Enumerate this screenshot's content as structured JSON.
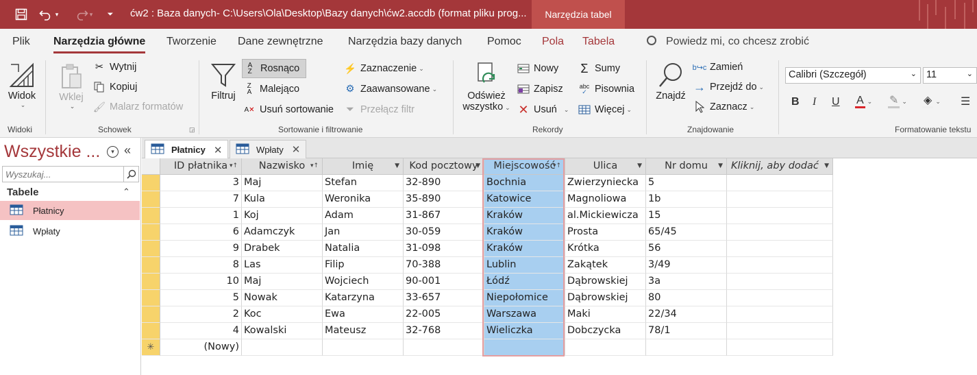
{
  "title_bar": {
    "title": "ćw2 : Baza danych- C:\\Users\\Ola\\Desktop\\Bazy danych\\ćw2.accdb (format pliku prog...",
    "context_tab": "Narzędzia tabel",
    "accent": "#a4373a"
  },
  "ribbon_tabs": [
    "Plik",
    "Narzędzia główne",
    "Tworzenie",
    "Dane zewnętrzne",
    "Narzędzia bazy danych",
    "Pomoc",
    "Pola",
    "Tabela"
  ],
  "active_tab": "Narzędzia główne",
  "tell_me": "Powiedz mi, co chcesz zrobić",
  "ribbon": {
    "widoki": {
      "widok": "Widok",
      "label": "Widoki"
    },
    "schowek": {
      "wklej": "Wklej",
      "wytnij": "Wytnij",
      "kopiuj": "Kopiuj",
      "malarz": "Malarz formatów",
      "label": "Schowek"
    },
    "sortowanie": {
      "filtruj": "Filtruj",
      "rosnaco": "Rosnąco",
      "malejaco": "Malejąco",
      "usun_sort": "Usuń sortowanie",
      "zaznaczenie": "Zaznaczenie",
      "zaawansowane": "Zaawansowane",
      "przelacz": "Przełącz filtr",
      "label": "Sortowanie i filtrowanie"
    },
    "rekordy": {
      "odswiez_1": "Odśwież",
      "odswiez_2": "wszystko",
      "nowy": "Nowy",
      "zapisz": "Zapisz",
      "usun": "Usuń",
      "sumy": "Sumy",
      "pisownia": "Pisownia",
      "wiecej": "Więcej",
      "label": "Rekordy"
    },
    "znajdowanie": {
      "znajdz": "Znajdź",
      "zamien": "Zamień",
      "przejdz": "Przejdź do",
      "zaznacz": "Zaznacz",
      "label": "Znajdowanie"
    },
    "formatowanie": {
      "font": "Calibri (Szczegół)",
      "size": "11",
      "label": "Formatowanie tekstu"
    }
  },
  "nav": {
    "title": "Wszystkie ...",
    "search_placeholder": "Wyszukaj...",
    "section": "Tabele",
    "items": [
      "Płatnicy",
      "Wpłaty"
    ]
  },
  "doc_tabs": [
    "Płatnicy",
    "Wpłaty"
  ],
  "table": {
    "columns": [
      "ID płatnika",
      "Nazwisko",
      "Imię",
      "Kod pocztowy",
      "Miejscowość",
      "Ulica",
      "Nr domu",
      "Kliknij, aby dodać"
    ],
    "rows": [
      [
        "3",
        "Maj",
        "Stefan",
        "32-890",
        "Bochnia",
        "Zwierzyniecka",
        "5"
      ],
      [
        "7",
        "Kula",
        "Weronika",
        "35-890",
        "Katowice",
        "Magnoliowa",
        "1b"
      ],
      [
        "1",
        "Koj",
        "Adam",
        "31-867",
        "Kraków",
        "al.Mickiewicza",
        "15"
      ],
      [
        "6",
        "Adamczyk",
        "Jan",
        "30-059",
        "Kraków",
        "Prosta",
        "65/45"
      ],
      [
        "9",
        "Drabek",
        "Natalia",
        "31-098",
        "Kraków",
        "Krótka",
        "56"
      ],
      [
        "8",
        "Las",
        "Filip",
        "70-388",
        "Lublin",
        "Zakątek",
        "3/49"
      ],
      [
        "10",
        "Maj",
        "Wojciech",
        "90-001",
        "Łódź",
        "Dąbrowskiej",
        "3a"
      ],
      [
        "5",
        "Nowak",
        "Katarzyna",
        "33-657",
        "Niepołomice",
        "Dąbrowskiej",
        "80"
      ],
      [
        "2",
        "Koc",
        "Ewa",
        "22-005",
        "Warszawa",
        "Maki",
        "22/34"
      ],
      [
        "4",
        "Kowalski",
        "Mateusz",
        "32-768",
        "Wieliczka",
        "Dobczycka",
        "78/1"
      ]
    ],
    "new_row_label": "(Nowy)",
    "new_row_marker": "✳"
  }
}
